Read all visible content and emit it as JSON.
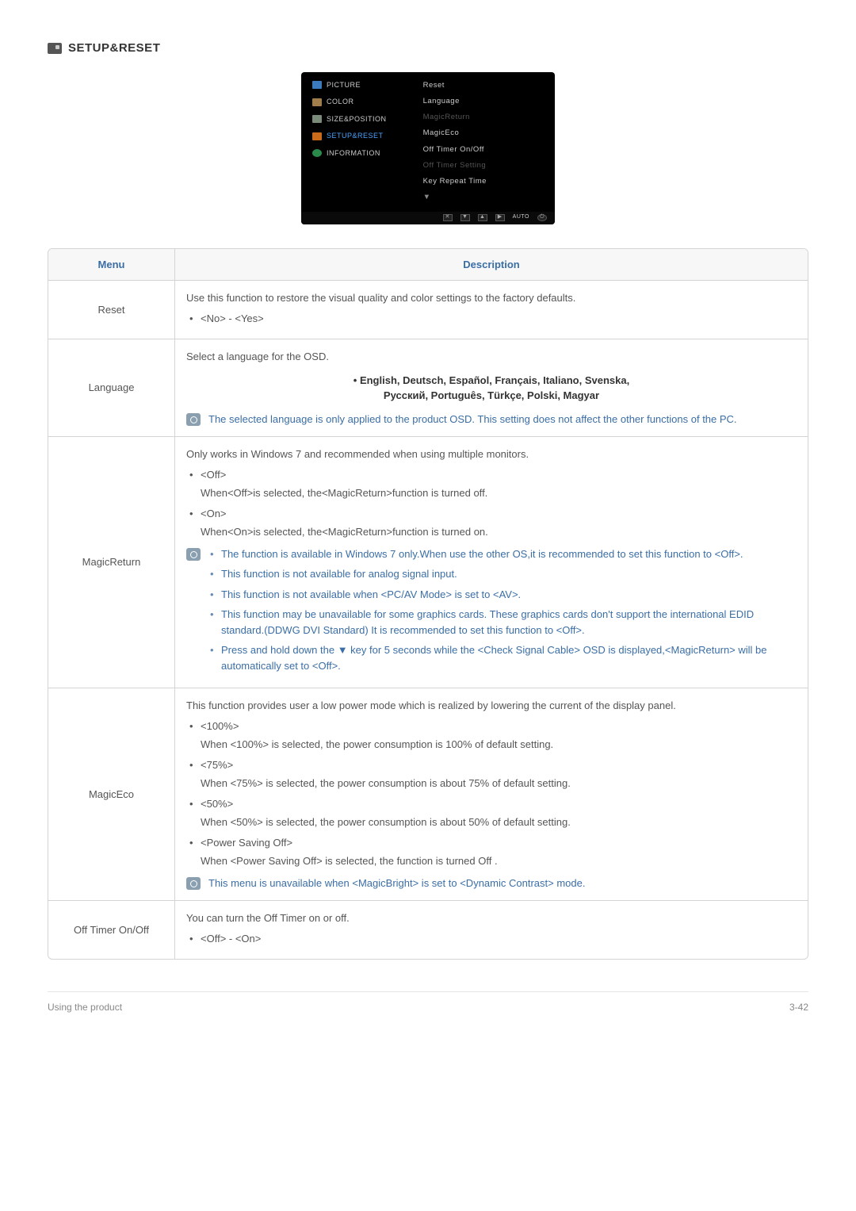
{
  "section": {
    "title": "SETUP&RESET"
  },
  "osd": {
    "left": {
      "picture": "PICTURE",
      "color": "COLOR",
      "sizepos": "SIZE&POSITION",
      "setupreset": "SETUP&RESET",
      "information": "INFORMATION"
    },
    "right": {
      "reset": "Reset",
      "language": "Language",
      "magicreturn": "MagicReturn",
      "magiceco": "MagicEco",
      "offtimer_onoff": "Off Timer On/Off",
      "offtimer_setting": "Off Timer Setting",
      "keyrepeat": "Key Repeat Time"
    },
    "footer": {
      "auto": "AUTO"
    }
  },
  "table": {
    "header_menu": "Menu",
    "header_desc": "Description",
    "rows": {
      "reset": {
        "label": "Reset",
        "text": "Use this function to restore the visual quality and color settings to the factory defaults.",
        "opts": "<No> - <Yes>"
      },
      "language": {
        "label": "Language",
        "intro": "Select a language for the OSD.",
        "list1": "• English, Deutsch, Español, Français, Italiano, Svenska,",
        "list2": "Русский, Português, Türkçe, Polski, Magyar",
        "note": "The selected language is only applied to the product OSD. This setting does not affect the other functions of the PC."
      },
      "magicreturn": {
        "label": "MagicReturn",
        "intro": "Only works in Windows 7 and recommended when using multiple monitors.",
        "off_label": "<Off>",
        "off_desc": "When<Off>is selected, the<MagicReturn>function is turned off.",
        "on_label": "<On>",
        "on_desc": "When<On>is selected, the<MagicReturn>function is turned on.",
        "n1": "The function is available in Windows 7 only.When use the other OS,it is recommended to set this function to <Off>.",
        "n2": "This function is not available for analog signal input.",
        "n3": "This function is not available when <PC/AV Mode> is set to <AV>.",
        "n4": "This function may be unavailable for some graphics cards. These graphics cards don't support the international EDID standard.(DDWG DVI Standard) It is recommended to set this function to <Off>.",
        "n5": "Press and hold down the ▼ key for 5 seconds while the <Check Signal Cable> OSD is displayed,<MagicReturn> will be automatically set to <Off>."
      },
      "magiceco": {
        "label": "MagicEco",
        "intro": "This function provides user a low power mode which is realized by lowering the current of the display panel.",
        "o1_label": "<100%>",
        "o1_desc": "When <100%> is selected, the power consumption is 100% of default setting.",
        "o2_label": "<75%>",
        "o2_desc": "When <75%> is selected, the power consumption is about 75% of default setting.",
        "o3_label": "<50%>",
        "o3_desc": "When <50%> is selected, the power consumption is about 50% of default setting.",
        "o4_label": "<Power Saving Off>",
        "o4_desc": "When <Power Saving Off> is selected, the function is turned Off .",
        "note": "This menu is unavailable when <MagicBright> is set to <Dynamic Contrast> mode."
      },
      "offtimer": {
        "label": "Off Timer On/Off",
        "text": "You can turn the Off Timer on or off.",
        "opts": "<Off> - <On>"
      }
    }
  },
  "footer": {
    "left": "Using the product",
    "right": "3-42"
  }
}
